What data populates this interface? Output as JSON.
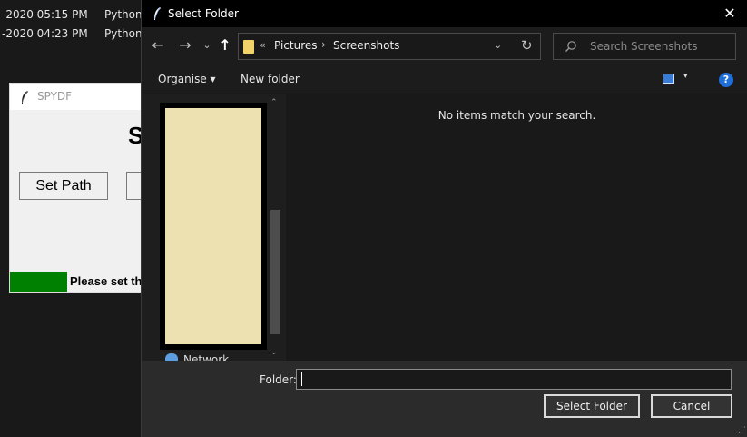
{
  "background_list": {
    "rows": [
      {
        "date": "-2020 05:15 PM",
        "type": "Python"
      },
      {
        "date": "-2020 04:23 PM",
        "type": "Python"
      }
    ]
  },
  "app": {
    "title": "SPYDF",
    "heading": "S",
    "set_path_label": "Set Path",
    "status_text": "Please set th",
    "status_color": "#008000"
  },
  "dialog": {
    "title": "Select Folder",
    "close_glyph": "✕",
    "nav": {
      "back": "←",
      "forward": "→",
      "recent": "⌄",
      "up": "↑"
    },
    "address": {
      "overflow": "«",
      "crumbs": [
        "Pictures",
        "Screenshots"
      ],
      "separator": "›",
      "dropdown": "⌄",
      "refresh": "↻"
    },
    "search": {
      "placeholder": "Search Screenshots"
    },
    "toolbar": {
      "organise": "Organise ▾",
      "new_folder": "New folder",
      "view_dropdown": "▾",
      "help": "?"
    },
    "navpane": {
      "network": "Network",
      "scroll_up": "⌃",
      "scroll_down": "⌄"
    },
    "content": {
      "empty_message": "No items match your search."
    },
    "footer": {
      "folder_label": "Folder:",
      "folder_value": "",
      "select_button": "Select Folder",
      "cancel_button": "Cancel"
    }
  }
}
